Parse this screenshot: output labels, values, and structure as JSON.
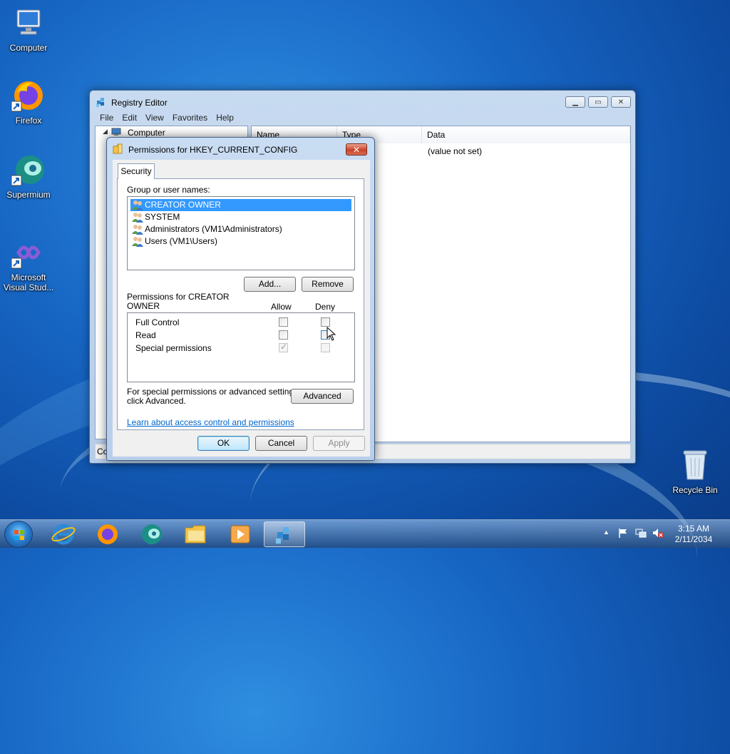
{
  "desktop": {
    "icons": [
      {
        "label": "Computer"
      },
      {
        "label": "Firefox"
      },
      {
        "label": "Supermium"
      },
      {
        "label": "Microsoft Visual Stud..."
      },
      {
        "label": "Recycle Bin"
      }
    ]
  },
  "registry_editor": {
    "title": "Registry Editor",
    "menu": [
      "File",
      "Edit",
      "View",
      "Favorites",
      "Help"
    ],
    "tree_root": "Computer",
    "columns": [
      "Name",
      "Type",
      "Data"
    ],
    "rows": [
      {
        "data": "(value not set)"
      }
    ],
    "status": "Co"
  },
  "permissions_dialog": {
    "title": "Permissions for HKEY_CURRENT_CONFIG",
    "tab": "Security",
    "group_label": "Group or user names:",
    "users": [
      "CREATOR OWNER",
      "SYSTEM",
      "Administrators (VM1\\Administrators)",
      "Users (VM1\\Users)"
    ],
    "selected_user_index": 0,
    "add_button": "Add...",
    "remove_button": "Remove",
    "perm_label_line1": "Permissions for CREATOR",
    "perm_label_line2": "OWNER",
    "allow_header": "Allow",
    "deny_header": "Deny",
    "permissions": [
      {
        "name": "Full Control",
        "allow": false,
        "deny": false
      },
      {
        "name": "Read",
        "allow": false,
        "deny": false
      },
      {
        "name": "Special permissions",
        "allow": true,
        "deny": false
      }
    ],
    "special_text_line1": "For special permissions or advanced settings,",
    "special_text_line2": "click Advanced.",
    "advanced_button": "Advanced",
    "learn_link": "Learn about access control and permissions",
    "ok_button": "OK",
    "cancel_button": "Cancel",
    "apply_button": "Apply"
  },
  "taskbar": {
    "time": "3:15 AM",
    "date": "2/11/2034"
  }
}
